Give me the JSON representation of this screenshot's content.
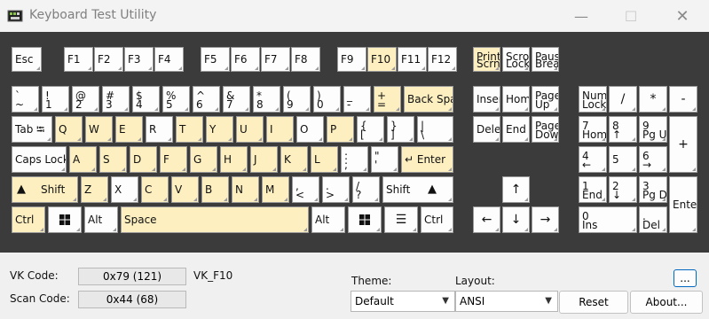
{
  "window": {
    "title": "Keyboard Test Utility",
    "controls": [
      {
        "name": "minimize-button",
        "glyph": "—"
      },
      {
        "name": "maximize-button",
        "glyph": "☐"
      },
      {
        "name": "close-button",
        "glyph": "✕"
      }
    ]
  },
  "colors": {
    "highlight": "#fdefc0",
    "key": "#fdfdfd",
    "keyboard_bg": "#3b3b3b"
  },
  "keys": [
    {
      "id": "esc",
      "label": "Esc",
      "hl": false
    },
    {
      "id": "f1",
      "label": "F1",
      "hl": false
    },
    {
      "id": "f2",
      "label": "F2",
      "hl": false
    },
    {
      "id": "f3",
      "label": "F3",
      "hl": false
    },
    {
      "id": "f4",
      "label": "F4",
      "hl": false
    },
    {
      "id": "f5",
      "label": "F5",
      "hl": false
    },
    {
      "id": "f6",
      "label": "F6",
      "hl": false
    },
    {
      "id": "f7",
      "label": "F7",
      "hl": false
    },
    {
      "id": "f8",
      "label": "F8",
      "hl": false
    },
    {
      "id": "f9",
      "label": "F9",
      "hl": false
    },
    {
      "id": "f10",
      "label": "F10",
      "hl": true
    },
    {
      "id": "f11",
      "label": "F11",
      "hl": false
    },
    {
      "id": "f12",
      "label": "F12",
      "hl": false
    },
    {
      "id": "print-screen",
      "top": "Print",
      "bottom": "Scrn",
      "hl": true
    },
    {
      "id": "scroll-lock",
      "top": "Scrol",
      "bottom": "Lock",
      "hl": false
    },
    {
      "id": "pause-break",
      "top": "Pause",
      "bottom": "Break",
      "hl": false
    },
    {
      "id": "backtick",
      "top": "`",
      "bottom": "~",
      "hl": false
    },
    {
      "id": "digit-1",
      "top": "!",
      "bottom": "1",
      "hl": false
    },
    {
      "id": "digit-2",
      "top": "@",
      "bottom": "2",
      "hl": false
    },
    {
      "id": "digit-3",
      "top": "#",
      "bottom": "3",
      "hl": false
    },
    {
      "id": "digit-4",
      "top": "$",
      "bottom": "4",
      "hl": false
    },
    {
      "id": "digit-5",
      "top": "%",
      "bottom": "5",
      "hl": false
    },
    {
      "id": "digit-6",
      "top": "^",
      "bottom": "6",
      "hl": false
    },
    {
      "id": "digit-7",
      "top": "&",
      "bottom": "7",
      "hl": false
    },
    {
      "id": "digit-8",
      "top": "*",
      "bottom": "8",
      "hl": false
    },
    {
      "id": "digit-9",
      "top": "(",
      "bottom": "9",
      "hl": false
    },
    {
      "id": "digit-0",
      "top": ")",
      "bottom": "0",
      "hl": false
    },
    {
      "id": "minus",
      "top": "_",
      "bottom": "-",
      "hl": false
    },
    {
      "id": "equals",
      "top": "+",
      "bottom": "=",
      "hl": true
    },
    {
      "id": "backspace",
      "label": "Back Space",
      "hl": true
    },
    {
      "id": "insert",
      "label": "Insert",
      "hl": false
    },
    {
      "id": "home",
      "label": "Home",
      "hl": false
    },
    {
      "id": "page-up",
      "top": "Page",
      "bottom": "Up",
      "hl": false
    },
    {
      "id": "num-lock",
      "top": "Num",
      "bottom": "Lock",
      "hl": false
    },
    {
      "id": "num-divide",
      "label": "/",
      "hl": false
    },
    {
      "id": "num-multiply",
      "label": "*",
      "hl": false
    },
    {
      "id": "num-minus",
      "label": "-",
      "hl": false
    },
    {
      "id": "tab",
      "label": "Tab ⭾",
      "hl": false
    },
    {
      "id": "q",
      "label": "Q",
      "hl": true
    },
    {
      "id": "w",
      "label": "W",
      "hl": true
    },
    {
      "id": "e",
      "label": "E",
      "hl": true
    },
    {
      "id": "r",
      "label": "R",
      "hl": false
    },
    {
      "id": "t",
      "label": "T",
      "hl": true
    },
    {
      "id": "y",
      "label": "Y",
      "hl": true
    },
    {
      "id": "u",
      "label": "U",
      "hl": true
    },
    {
      "id": "i",
      "label": "I",
      "hl": true
    },
    {
      "id": "o",
      "label": "O",
      "hl": false
    },
    {
      "id": "p",
      "label": "P",
      "hl": true
    },
    {
      "id": "bracket-left",
      "top": "{",
      "bottom": "[",
      "hl": false
    },
    {
      "id": "bracket-right",
      "top": "}",
      "bottom": "]",
      "hl": false
    },
    {
      "id": "backslash",
      "top": "|",
      "bottom": "\\",
      "hl": false
    },
    {
      "id": "delete",
      "label": "Delete",
      "hl": false
    },
    {
      "id": "end",
      "label": "End",
      "hl": false
    },
    {
      "id": "page-down",
      "top": "Page",
      "bottom": "Down",
      "hl": false
    },
    {
      "id": "num-7",
      "top": "7",
      "bottom": "Home",
      "hl": false
    },
    {
      "id": "num-8",
      "top": "8",
      "bottom": "↑",
      "hl": false
    },
    {
      "id": "num-9",
      "top": "9",
      "bottom": "Pg Up",
      "hl": false
    },
    {
      "id": "num-plus",
      "label": "+",
      "hl": false
    },
    {
      "id": "caps-lock",
      "label": "Caps Lock",
      "hl": false
    },
    {
      "id": "a",
      "label": "A",
      "hl": true
    },
    {
      "id": "s",
      "label": "S",
      "hl": true
    },
    {
      "id": "d",
      "label": "D",
      "hl": true
    },
    {
      "id": "f",
      "label": "F",
      "hl": true
    },
    {
      "id": "g",
      "label": "G",
      "hl": true
    },
    {
      "id": "h",
      "label": "H",
      "hl": true
    },
    {
      "id": "j",
      "label": "J",
      "hl": true
    },
    {
      "id": "k",
      "label": "K",
      "hl": true
    },
    {
      "id": "l",
      "label": "L",
      "hl": true
    },
    {
      "id": "semicolon",
      "top": ":",
      "bottom": ";",
      "hl": false
    },
    {
      "id": "quote",
      "top": "\"",
      "bottom": "'",
      "hl": false
    },
    {
      "id": "enter",
      "label": "↵ Enter",
      "hl": true
    },
    {
      "id": "num-4",
      "top": "4",
      "bottom": "←",
      "hl": false
    },
    {
      "id": "num-5",
      "label": "5",
      "hl": false
    },
    {
      "id": "num-6",
      "top": "6",
      "bottom": "→",
      "hl": false
    },
    {
      "id": "shift-left",
      "label": "Shift",
      "hl": true
    },
    {
      "id": "z",
      "label": "Z",
      "hl": true
    },
    {
      "id": "x",
      "label": "X",
      "hl": false
    },
    {
      "id": "c",
      "label": "C",
      "hl": true
    },
    {
      "id": "v",
      "label": "V",
      "hl": true
    },
    {
      "id": "b",
      "label": "B",
      "hl": true
    },
    {
      "id": "n",
      "label": "N",
      "hl": true
    },
    {
      "id": "m",
      "label": "M",
      "hl": true
    },
    {
      "id": "comma",
      "top": ",",
      "bottom": "<",
      "hl": false
    },
    {
      "id": "period",
      "top": ".",
      "bottom": ">",
      "hl": false
    },
    {
      "id": "slash",
      "top": "/",
      "bottom": "?",
      "hl": false
    },
    {
      "id": "shift-right",
      "label": "Shift",
      "hl": false
    },
    {
      "id": "arrow-up",
      "label": "↑",
      "hl": false
    },
    {
      "id": "num-1",
      "top": "1",
      "bottom": "End",
      "hl": false
    },
    {
      "id": "num-2",
      "top": "2",
      "bottom": "↓",
      "hl": false
    },
    {
      "id": "num-3",
      "top": "3",
      "bottom": "Pg Dn",
      "hl": false
    },
    {
      "id": "num-enter",
      "label": "Enter",
      "hl": false
    },
    {
      "id": "ctrl-left",
      "label": "Ctrl",
      "hl": true
    },
    {
      "id": "win-left",
      "label": "",
      "hl": false
    },
    {
      "id": "alt-left",
      "label": "Alt",
      "hl": false
    },
    {
      "id": "space",
      "label": "Space",
      "hl": true
    },
    {
      "id": "alt-right",
      "label": "Alt",
      "hl": false
    },
    {
      "id": "win-right",
      "label": "",
      "hl": false
    },
    {
      "id": "menu",
      "label": "☰",
      "hl": false
    },
    {
      "id": "ctrl-right",
      "label": "Ctrl",
      "hl": false
    },
    {
      "id": "arrow-left",
      "label": "←",
      "hl": false
    },
    {
      "id": "arrow-down",
      "label": "↓",
      "hl": false
    },
    {
      "id": "arrow-right",
      "label": "→",
      "hl": false
    },
    {
      "id": "num-0",
      "top": "0",
      "bottom": "Ins",
      "hl": false
    },
    {
      "id": "num-decimal",
      "top": ".",
      "bottom": "Del",
      "hl": false
    }
  ],
  "info": {
    "vk_label": "VK Code:",
    "vk_value": "0x79 (121)",
    "vk_name": "VK_F10",
    "scan_label": "Scan Code:",
    "scan_value": "0x44 (68)"
  },
  "controls": {
    "theme_label": "Theme:",
    "theme_value": "Default",
    "layout_label": "Layout:",
    "layout_value": "ANSI",
    "more_button": "...",
    "reset_button": "Reset",
    "about_button": "About..."
  }
}
